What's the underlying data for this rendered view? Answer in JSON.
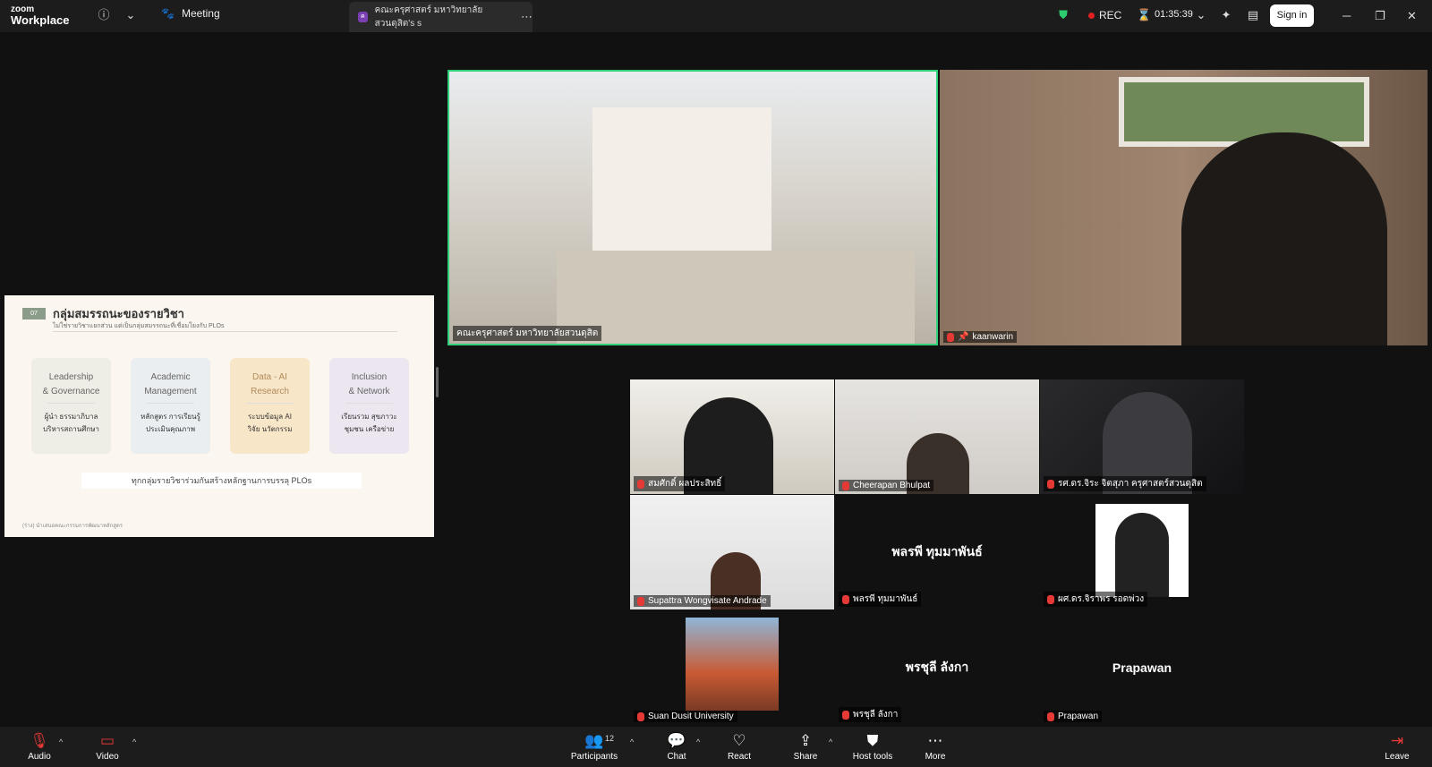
{
  "titlebar": {
    "brand_small": "zoom",
    "brand_big": "Workplace",
    "meeting_label": "Meeting",
    "active_tab_label": "คณะครุศาสตร์ มหาวิทยาลัยสวนดุสิต's s",
    "rec_label": "REC",
    "timer": "01:35:39",
    "signin_label": "Sign in"
  },
  "share": {
    "num": "07",
    "title": "กลุ่มสมรรถนะของรายวิชา",
    "subtitle": "ไม่ใช่รายวิชาแยกส่วน แต่เป็นกลุ่มสมรรถนะที่เชื่อมโยงกับ PLOs",
    "cards": [
      {
        "head1": "Leadership",
        "head2": "& Governance",
        "body1": "ผู้นำ ธรรมาภิบาล",
        "body2": "บริหารสถานศึกษา",
        "bg": "#efeee6"
      },
      {
        "head1": "Academic",
        "head2": "Management",
        "body1": "หลักสูตร การเรียนรู้",
        "body2": "ประเมินคุณภาพ",
        "bg": "#eaeef0"
      },
      {
        "head1": "Data - AI",
        "head2": "Research",
        "body1": "ระบบข้อมูล AI",
        "body2": "วิจัย นวัตกรรม",
        "bg": "#f8e6c8"
      },
      {
        "head1": "Inclusion",
        "head2": "& Network",
        "body1": "เรียนรวม สุขภาวะ",
        "body2": "ชุมชน เครือข่าย",
        "bg": "#ece6f0"
      }
    ],
    "bottom": "ทุกกลุ่มรายวิชาร่วมกันสร้างหลักฐานการบรรลุ PLOs",
    "footer": "(ร่าง) นำเสนอคณะกรรมการพัฒนาหลักสูตร"
  },
  "participants": {
    "main1": "คณะครุศาสตร์ มหาวิทยาลัยสวนดุสิต",
    "main2": "kaanwarin",
    "p1": "สมศักดิ์ ผลประสิทธิ์",
    "p2": "Cheerapan Bhulpat",
    "p3": "รศ.ดร.จิระ จิตสุภา ครุศาสตร์สวนดุสิต",
    "p4": "Supattra Wongvisate Andrade",
    "p5": "พลรพี ทุมมาพันธ์",
    "p6": "ผศ.ดร.จิราพร รอดพ่วง",
    "p7": "Suan Dusit University",
    "p8": "พรชุลี ลังกา",
    "p9": "Prapawan"
  },
  "toolbar": {
    "audio": "Audio",
    "video": "Video",
    "participants": "Participants",
    "participants_count": "12",
    "chat": "Chat",
    "react": "React",
    "share": "Share",
    "host_tools": "Host tools",
    "more": "More",
    "leave": "Leave"
  }
}
